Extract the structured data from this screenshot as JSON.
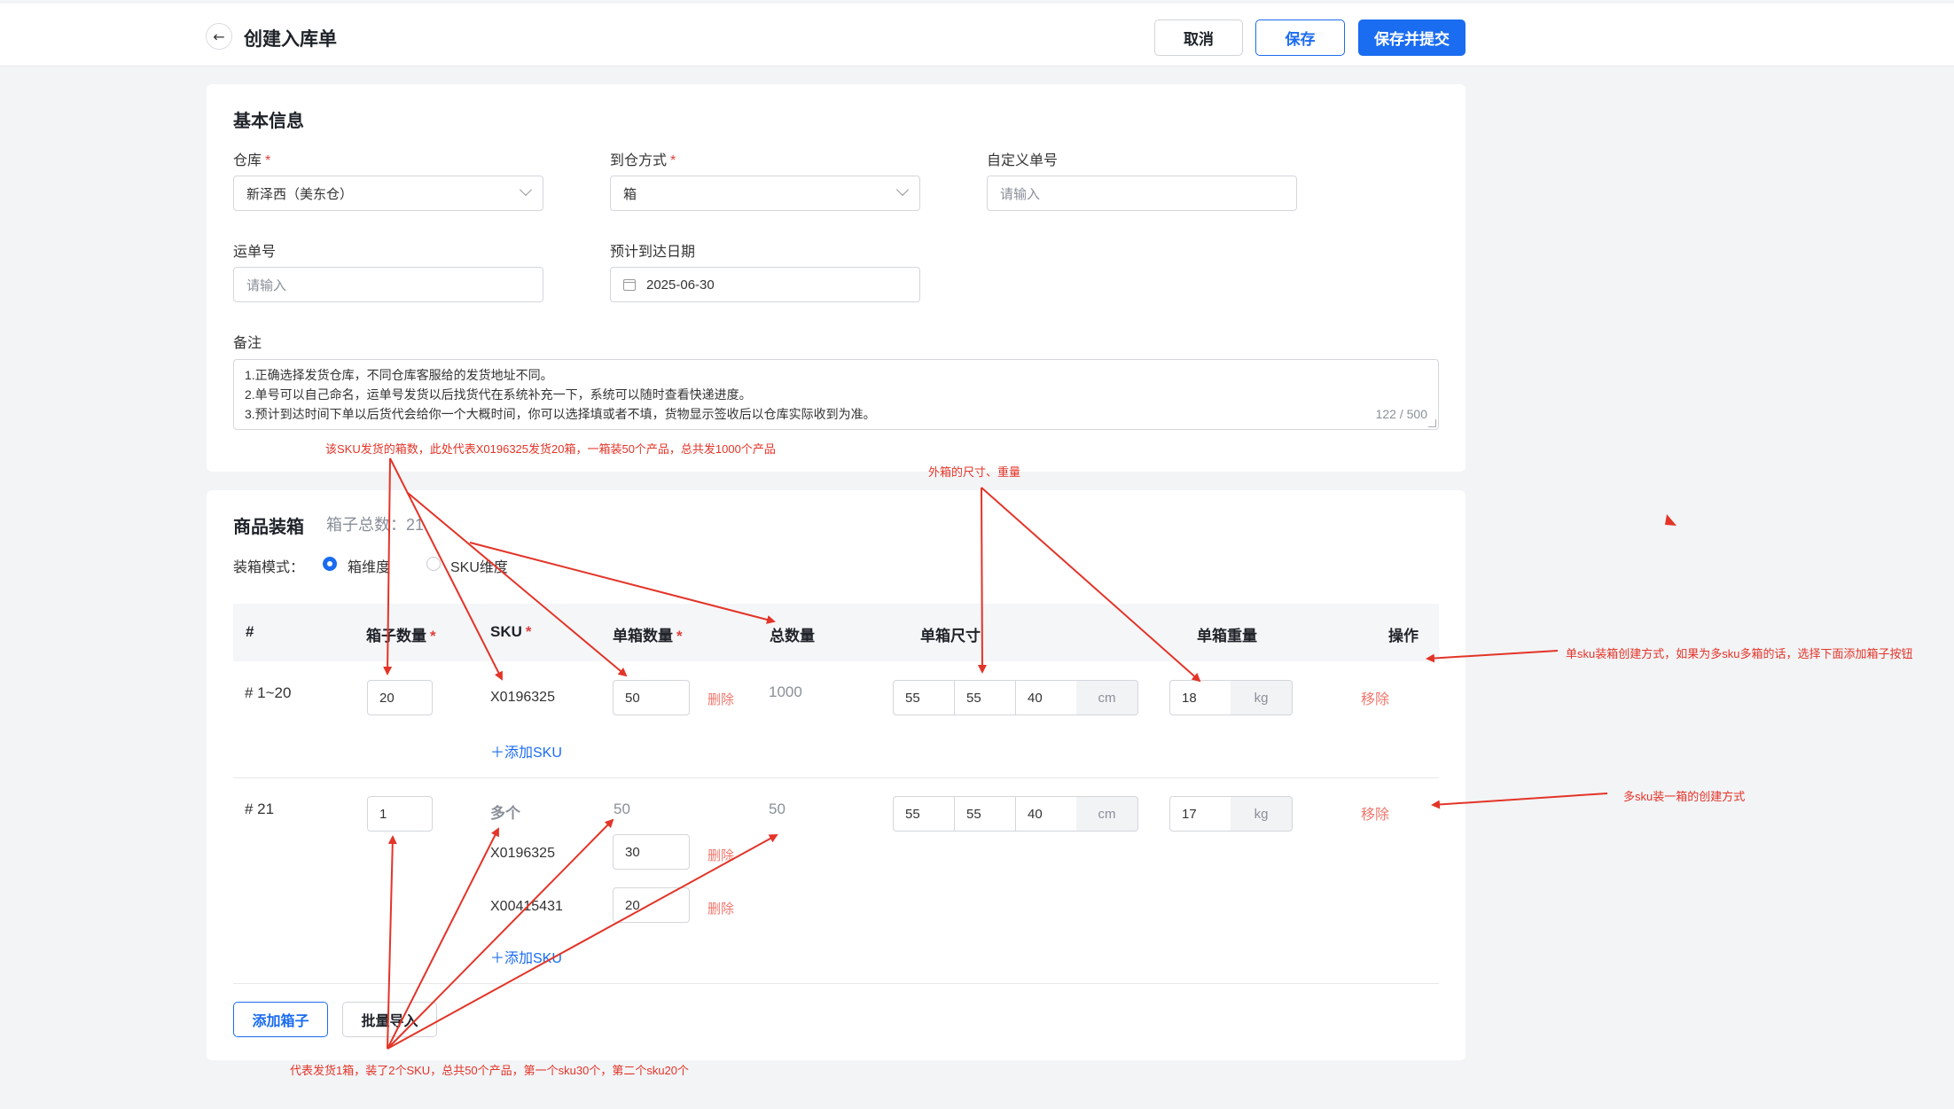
{
  "header": {
    "title": "创建入库单",
    "cancel_label": "取消",
    "save_label": "保存",
    "submit_label": "保存并提交"
  },
  "basic_info": {
    "section_title": "基本信息",
    "warehouse": {
      "label": "仓库",
      "value": "新泽西（美东仓）"
    },
    "arrival_method": {
      "label": "到仓方式",
      "value": "箱"
    },
    "custom_number": {
      "label": "自定义单号",
      "placeholder": "请输入"
    },
    "waybill": {
      "label": "运单号",
      "placeholder": "请输入"
    },
    "eta": {
      "label": "预计到达日期",
      "value": "2025-06-30"
    },
    "remark": {
      "label": "备注",
      "lines": [
        "1.正确选择发货仓库，不同仓库客服给的发货地址不同。",
        "2.单号可以自己命名，运单号发货以后找货代在系统补充一下，系统可以随时查看快递进度。",
        "3.预计到达时间下单以后货代会给你一个大概时间，你可以选择填或者不填，货物显示签收后以仓库实际收到为准。"
      ],
      "counter": "122 / 500"
    },
    "required_mark": "*"
  },
  "packing": {
    "section_title": "商品装箱",
    "box_total_label": "箱子总数：21",
    "mode_label": "装箱模式：",
    "mode_options": [
      "箱维度",
      "SKU维度"
    ],
    "mode_selected": "箱维度",
    "columns": [
      "#",
      "箱子数量",
      "SKU",
      "单箱数量",
      "总数量",
      "单箱尺寸",
      "单箱重量",
      "操作"
    ],
    "rows": [
      {
        "index": "# 1~20",
        "box_qty": "20",
        "skus": [
          {
            "sku": "X0196325",
            "qty": "50",
            "delete": "删除"
          }
        ],
        "total": "1000",
        "dims": [
          "55",
          "55",
          "40"
        ],
        "dim_unit": "cm",
        "weight": "18",
        "weight_unit": "kg",
        "remove": "移除",
        "add_sku": "＋添加SKU"
      },
      {
        "index": "# 21",
        "box_qty": "1",
        "sku_summary": "多个",
        "qty_summary": "50",
        "skus": [
          {
            "sku": "X0196325",
            "qty": "30",
            "delete": "删除"
          },
          {
            "sku": "X00415431",
            "qty": "20",
            "delete": "删除"
          }
        ],
        "total": "50",
        "dims": [
          "55",
          "55",
          "40"
        ],
        "dim_unit": "cm",
        "weight": "17",
        "weight_unit": "kg",
        "remove": "移除",
        "add_sku": "＋添加SKU"
      }
    ],
    "add_box_label": "添加箱子",
    "batch_import_label": "批量导入"
  },
  "annotations": {
    "box_count_note": "该SKU发货的箱数，此处代表X0196325发货20箱，一箱装50个产品，总共发1000个产品",
    "dims_note": "外箱的尺寸、重量",
    "single_sku_note": "单sku装箱创建方式，如果为多sku多箱的话，选择下面添加箱子按钮",
    "multi_sku_note": "多sku装一箱的创建方式",
    "bottom_note": "代表发货1箱，装了2个SKU，总共50个产品，第一个sku30个，第二个sku20个"
  },
  "colors": {
    "primary": "#1a6cf0",
    "danger_link": "#f0776d",
    "annotation": "#e33428"
  }
}
